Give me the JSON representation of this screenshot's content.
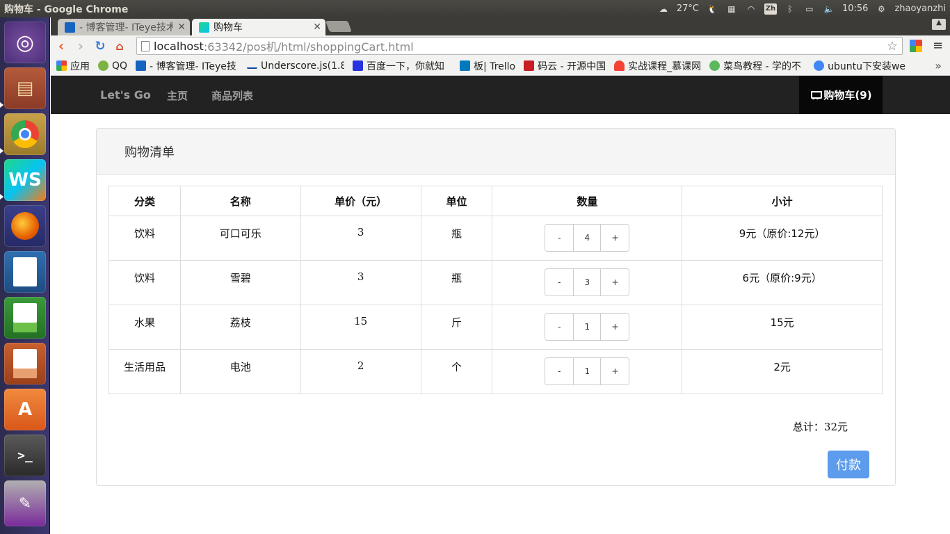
{
  "os": {
    "window_title": "购物车 - Google Chrome",
    "weather": "27°C",
    "input_method": "Zh",
    "time": "10:56",
    "user": "zhaoyanzhi"
  },
  "browser": {
    "tabs": [
      {
        "label": "- 博客管理- ITeye技术",
        "active": false
      },
      {
        "label": "购物车",
        "active": true
      }
    ],
    "url_host": "localhost",
    "url_path": ":63342/pos机/html/shoppingCart.html",
    "bookmarks": [
      {
        "label": "应用",
        "color": "#e94235"
      },
      {
        "label": "QQ",
        "color": "#7cb342"
      },
      {
        "label": "- 博客管理- ITeye技",
        "color": "#1565c0"
      },
      {
        "label": "Underscore.js(1.8",
        "color": "#0d47a1"
      },
      {
        "label": "百度一下，你就知",
        "color": "#2932e1"
      },
      {
        "label": "板| Trello",
        "color": "#0079bf"
      },
      {
        "label": "码云 - 开源中国",
        "color": "#c71d23"
      },
      {
        "label": "实战课程_慕课网",
        "color": "#f44336"
      },
      {
        "label": "菜鸟教程 - 学的不",
        "color": "#5cb85c"
      },
      {
        "label": "ubuntu下安装we",
        "color": "#4285f4"
      }
    ]
  },
  "navbar": {
    "brand": "Let's Go",
    "links": [
      "主页",
      "商品列表"
    ],
    "cart_label": "购物车(9)"
  },
  "panel": {
    "title": "购物清单",
    "columns": [
      "分类",
      "名称",
      "单价（元）",
      "单位",
      "数量",
      "小计"
    ],
    "rows": [
      {
        "category": "饮料",
        "name": "可口可乐",
        "price": "3",
        "unit": "瓶",
        "qty": "4",
        "subtotal": "9元（原价:12元）"
      },
      {
        "category": "饮料",
        "name": "雪碧",
        "price": "3",
        "unit": "瓶",
        "qty": "3",
        "subtotal": "6元（原价:9元）"
      },
      {
        "category": "水果",
        "name": "荔枝",
        "price": "15",
        "unit": "斤",
        "qty": "1",
        "subtotal": "15元"
      },
      {
        "category": "生活用品",
        "name": "电池",
        "price": "2",
        "unit": "个",
        "qty": "1",
        "subtotal": "2元"
      }
    ],
    "minus": "-",
    "plus": "+",
    "total_label": "总计：",
    "total_value": "32元",
    "pay_label": "付款"
  },
  "colors": {
    "navbar_bg": "#222222",
    "pay_button": "#5d9cec",
    "launcher_bg": "#3c3770"
  }
}
